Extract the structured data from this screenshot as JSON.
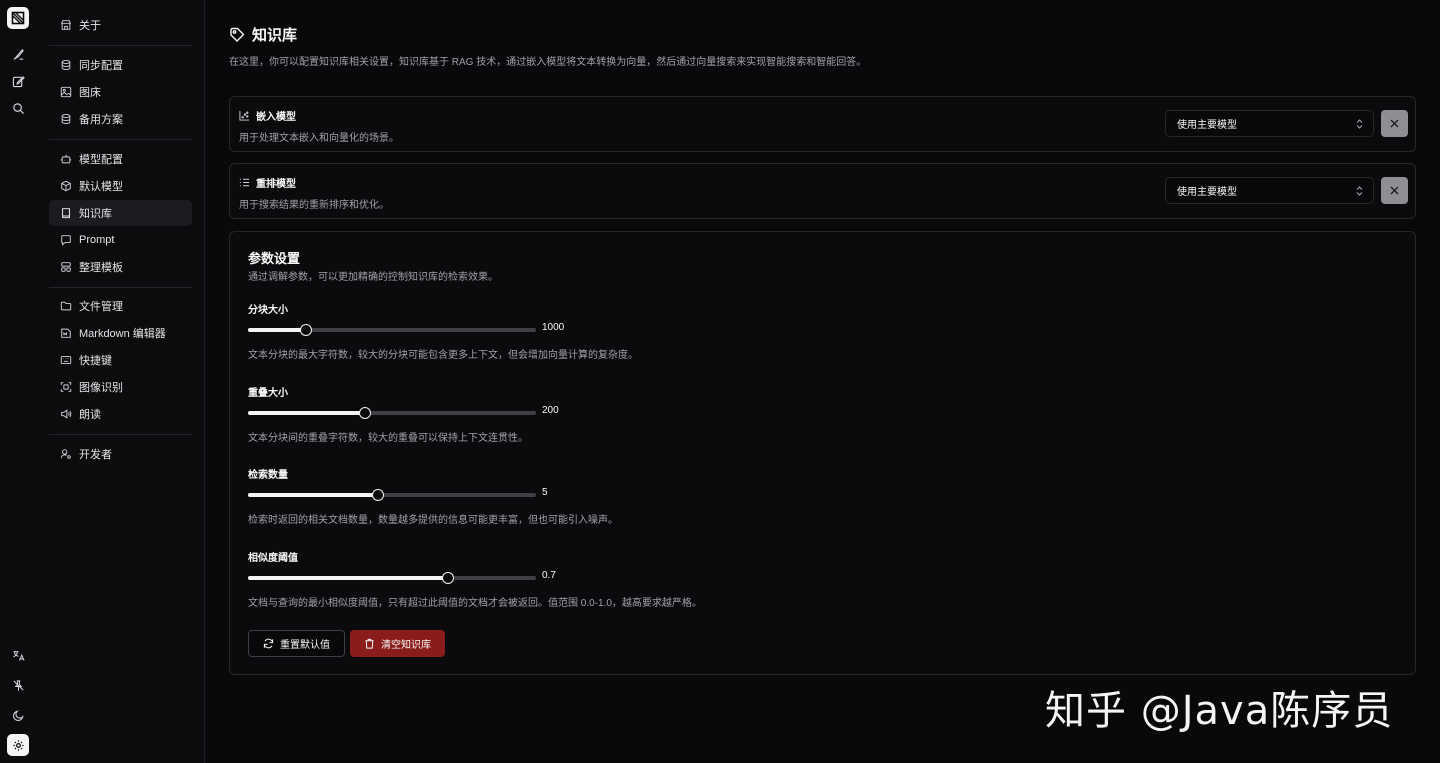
{
  "rail": {
    "logo": "app-logo",
    "top_icons": [
      "brush-icon",
      "edit-icon",
      "search-icon"
    ],
    "bottom_icons": [
      "language-icon",
      "pin-off-icon",
      "moon-icon",
      "settings-icon"
    ]
  },
  "sidebar": {
    "items": [
      {
        "label": "关于",
        "icon": "store-icon"
      },
      {
        "label": "同步配置",
        "icon": "database-sync-icon"
      },
      {
        "label": "图床",
        "icon": "image-icon"
      },
      {
        "label": "备用方案",
        "icon": "database-icon"
      },
      {
        "label": "模型配置",
        "icon": "bot-icon"
      },
      {
        "label": "默认模型",
        "icon": "box-icon"
      },
      {
        "label": "知识库",
        "icon": "book-icon",
        "active": true
      },
      {
        "label": "Prompt",
        "icon": "message-icon"
      },
      {
        "label": "整理模板",
        "icon": "template-icon"
      },
      {
        "label": "文件管理",
        "icon": "folder-icon"
      },
      {
        "label": "Markdown 编辑器",
        "icon": "markdown-icon"
      },
      {
        "label": "快捷键",
        "icon": "keyboard-icon"
      },
      {
        "label": "图像识别",
        "icon": "scan-icon"
      },
      {
        "label": "朗读",
        "icon": "speaker-icon"
      },
      {
        "label": "开发者",
        "icon": "user-cog-icon"
      }
    ]
  },
  "page": {
    "title": "知识库",
    "description": "在这里，你可以配置知识库相关设置，知识库基于 RAG 技术，通过嵌入模型将文本转换为向量，然后通过向量搜索来实现智能搜索和智能回答。"
  },
  "embedding": {
    "title": "嵌入模型",
    "description": "用于处理文本嵌入和向量化的场景。",
    "selected": "使用主要模型"
  },
  "rerank": {
    "title": "重排模型",
    "description": "用于搜索结果的重新排序和优化。",
    "selected": "使用主要模型"
  },
  "params": {
    "title": "参数设置",
    "description": "通过调解参数，可以更加精确的控制知识库的检索效果。",
    "sliders": [
      {
        "label": "分块大小",
        "value": "1000",
        "fraction": 0.2,
        "help": "文本分块的最大字符数，较大的分块可能包含更多上下文，但会增加向量计算的复杂度。"
      },
      {
        "label": "重叠大小",
        "value": "200",
        "fraction": 0.405,
        "help": "文本分块间的重叠字符数，较大的重叠可以保持上下文连贯性。"
      },
      {
        "label": "检索数量",
        "value": "5",
        "fraction": 0.45,
        "help": "检索时返回的相关文档数量，数量越多提供的信息可能更丰富，但也可能引入噪声。"
      },
      {
        "label": "相似度阈值",
        "value": "0.7",
        "fraction": 0.695,
        "help": "文档与查询的最小相似度阈值，只有超过此阈值的文档才会被返回。值范围 0.0-1.0，越高要求越严格。"
      }
    ],
    "reset_label": "重置默认值",
    "clear_label": "清空知识库"
  },
  "watermark": "知乎 @Java陈序员",
  "colors": {
    "background": "#09090b",
    "danger": "#8b1c1c",
    "active_item": "#1c1c20"
  }
}
